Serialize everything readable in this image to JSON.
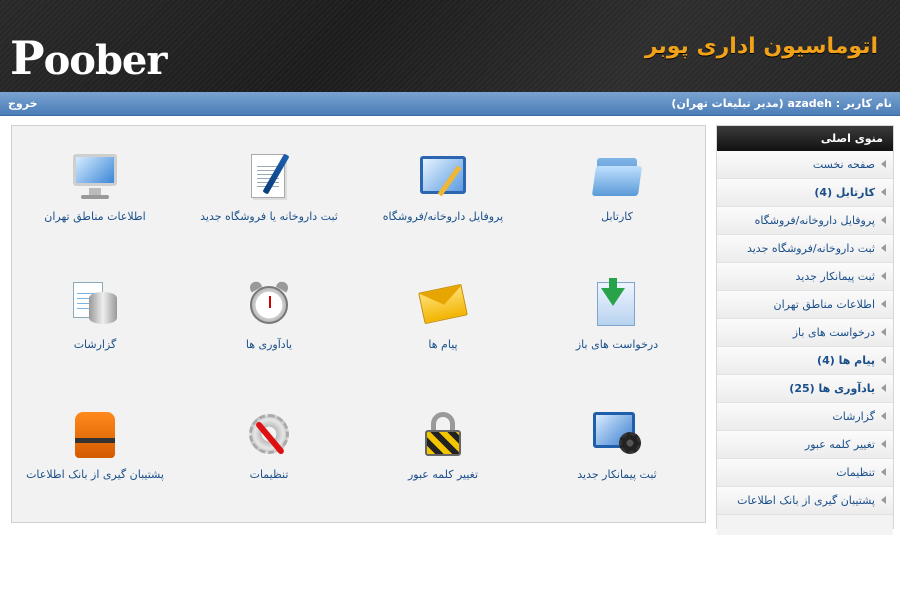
{
  "header": {
    "logo_text_big": "P",
    "logo_text_rest": "oober",
    "app_title": "اتوماسیون اداری پوبر"
  },
  "userbar": {
    "user_label": "نام کاربر :",
    "username": "azadeh",
    "role": "(مدیر تبلیغات تهران)",
    "logout": "خروج"
  },
  "tiles": [
    {
      "label": "کارتابل",
      "icon": "folder-icon"
    },
    {
      "label": "پروفایل داروخانه/فروشگاه",
      "icon": "profile-picture-icon"
    },
    {
      "label": "ثبت داروخانه یا فروشگاه جدید",
      "icon": "document-pen-icon"
    },
    {
      "label": "اطلاعات مناطق تهران",
      "icon": "monitor-icon"
    },
    {
      "label": "درخواست های باز",
      "icon": "download-documents-icon"
    },
    {
      "label": "پیام ها",
      "icon": "envelope-icon"
    },
    {
      "label": "یادآوری ها",
      "icon": "alarm-clock-icon"
    },
    {
      "label": "گزارشات",
      "icon": "database-report-icon"
    },
    {
      "label": "ثبت پیمانکار جدید",
      "icon": "settings-screen-icon"
    },
    {
      "label": "تغییر کلمه عبور",
      "icon": "padlock-icon"
    },
    {
      "label": "تنظیمات",
      "icon": "gear-wrench-icon"
    },
    {
      "label": "پشتیبان گیری از بانک اطلاعات",
      "icon": "life-vest-icon"
    }
  ],
  "sidebar": {
    "title": "منوی اصلی",
    "items": [
      {
        "label": "صفحه نخست"
      },
      {
        "label": "کارتابل (4)"
      },
      {
        "label": "پروفایل داروخانه/فروشگاه"
      },
      {
        "label": "ثبت داروخانه/فروشگاه جدید"
      },
      {
        "label": "ثبت پیمانکار جدید"
      },
      {
        "label": "اطلاعات مناطق تهران"
      },
      {
        "label": "درخواست های باز"
      },
      {
        "label": "پیام ها (4)"
      },
      {
        "label": "یادآوری ها (25)"
      },
      {
        "label": "گزارشات"
      },
      {
        "label": "تغییر کلمه عبور"
      },
      {
        "label": "تنظیمات"
      },
      {
        "label": "پشتیبان گیری از بانک اطلاعات"
      }
    ]
  },
  "colors": {
    "header_bg": "#1b1b1b",
    "title_orange": "#f1a21a",
    "userbar_blue": "#5f8fc6",
    "link_blue": "#1a4f8a"
  }
}
